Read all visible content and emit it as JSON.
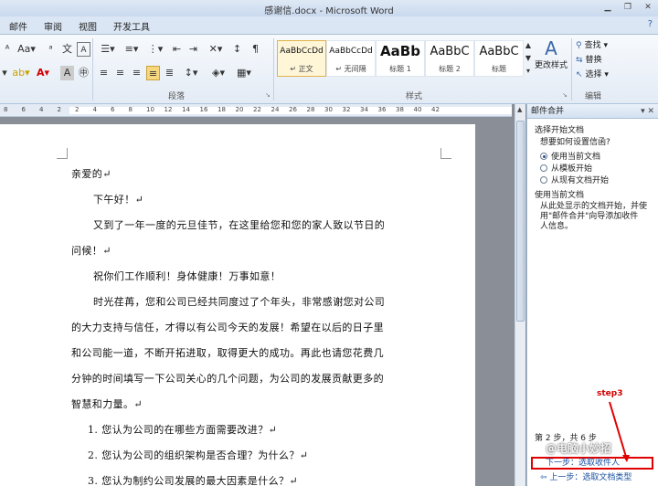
{
  "window": {
    "title": "感谢信.docx - Microsoft Word"
  },
  "tabs": [
    "邮件",
    "审阅",
    "视图",
    "开发工具"
  ],
  "ribbon": {
    "groups": {
      "paragraph": "段落",
      "styles": "样式",
      "editing": "编辑"
    },
    "styles": [
      {
        "preview": "AaBbCcDd",
        "name": "↵ 正文"
      },
      {
        "preview": "AaBbCcDd",
        "name": "↵ 无间隔"
      },
      {
        "preview": "AaBb",
        "name": "标题 1"
      },
      {
        "preview": "AaBbC",
        "name": "标题 2"
      },
      {
        "preview": "AaBbC",
        "name": "标题"
      }
    ],
    "change_styles": "更改样式",
    "editing": {
      "find": "查找",
      "replace": "替换",
      "select": "选择"
    }
  },
  "ruler_numbers": [
    "8",
    "6",
    "4",
    "2",
    "2",
    "4",
    "6",
    "8",
    "10",
    "12",
    "14",
    "16",
    "18",
    "20",
    "22",
    "24",
    "26",
    "28",
    "30",
    "32",
    "34",
    "36",
    "38",
    "40",
    "42"
  ],
  "document": {
    "lines": [
      "亲爱的↵",
      "下午好！↵",
      "又到了一年一度的元旦佳节，在这里给您和您的家人致以节日的",
      "问候！↵",
      "祝你们工作顺利！身体健康！万事如意！",
      "时光荏苒，您和公司已经共同度过了个年头，非常感谢您对公司",
      "的大力支持与信任，才得以有公司今天的发展！希望在以后的日子里",
      "和公司能一道，不断开拓进取，取得更大的成功。再此也请您花费几",
      "分钟的时间填写一下公司关心的几个问题，为公司的发展贡献更多的",
      "智慧和力量。↵",
      "1.  您认为公司的在哪些方面需要改进？↵",
      "2.  您认为公司的组织架构是否合理？为什么？↵",
      "3.  您认为制约公司发展的最大因素是什么？↵"
    ]
  },
  "mail_merge": {
    "title": "邮件合并",
    "section1": "选择开始文档",
    "question": "想要如何设置信函?",
    "options": [
      "使用当前文档",
      "从模板开始",
      "从现有文档开始"
    ],
    "section2": "使用当前文档",
    "desc": [
      "从此处显示的文档开始，并使",
      "用\"邮件合并\"向导添加收件",
      "人信息。"
    ],
    "step_count": "第 2 步，共 6 步",
    "next": "下一步：选取收件人",
    "prev": "上一步：选取文档类型",
    "annotation": "step3",
    "watermark": "@电脑小妙招"
  }
}
